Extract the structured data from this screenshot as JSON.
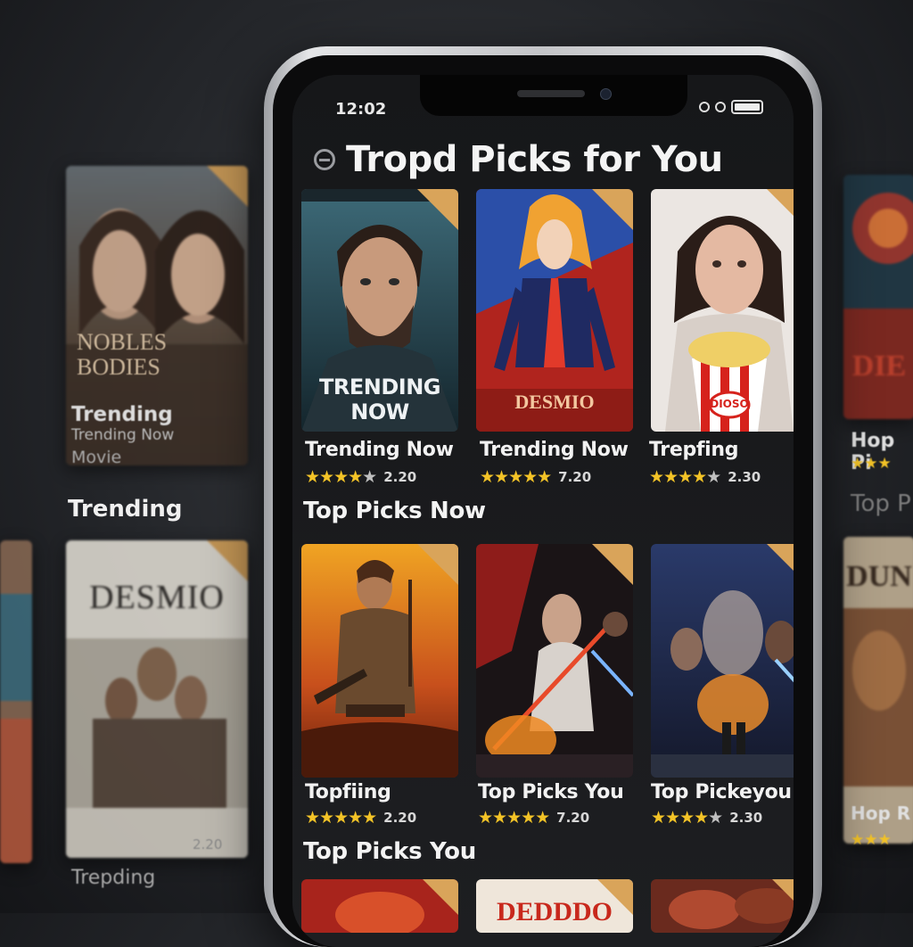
{
  "status_bar": {
    "time": "12:02"
  },
  "app": {
    "title": "Tropd Picks for You"
  },
  "sections": {
    "row1": {
      "items": [
        {
          "poster_title": "TRENDING NOW",
          "caption": "Trending Now",
          "rating": 4,
          "score": "2.20"
        },
        {
          "poster_title": "DESMIO",
          "caption": "Trending Now",
          "rating": 5,
          "score": "7.20"
        },
        {
          "poster_title": "DIOSO",
          "caption": "Trepfing",
          "rating": 4.5,
          "score": "2.30"
        }
      ]
    },
    "row2": {
      "heading": "Top Picks Now",
      "items": [
        {
          "caption": "Topfiing",
          "rating": 5,
          "score": "2.20"
        },
        {
          "caption": "Top Picks You",
          "rating": 5,
          "score": "7.20"
        },
        {
          "caption": "Top Pickeyou",
          "rating": 4.5,
          "score": "2.30"
        }
      ]
    },
    "row3": {
      "heading": "Top Picks You",
      "items": [
        {
          "poster_title": ""
        },
        {
          "poster_title": "DEDDDO"
        },
        {
          "poster_title": ""
        }
      ]
    }
  },
  "background": {
    "left": {
      "poster1_title": "NOBLES BODIES",
      "caption1": "Trending",
      "caption1b": "Trending Now",
      "caption1c": "Movie",
      "section": "Trending",
      "poster2_title": "DESMIO",
      "caption2": "Trepding",
      "score2": "2.20"
    },
    "right": {
      "poster1_title": "DIE",
      "caption1": "Hop Pi",
      "section": "Top P",
      "poster2_title": "DUN",
      "caption2": "Hop R"
    }
  },
  "colors": {
    "star": "#f3c327",
    "ribbon": "#d9a45a",
    "screen_bg": "#1a1b1e"
  }
}
